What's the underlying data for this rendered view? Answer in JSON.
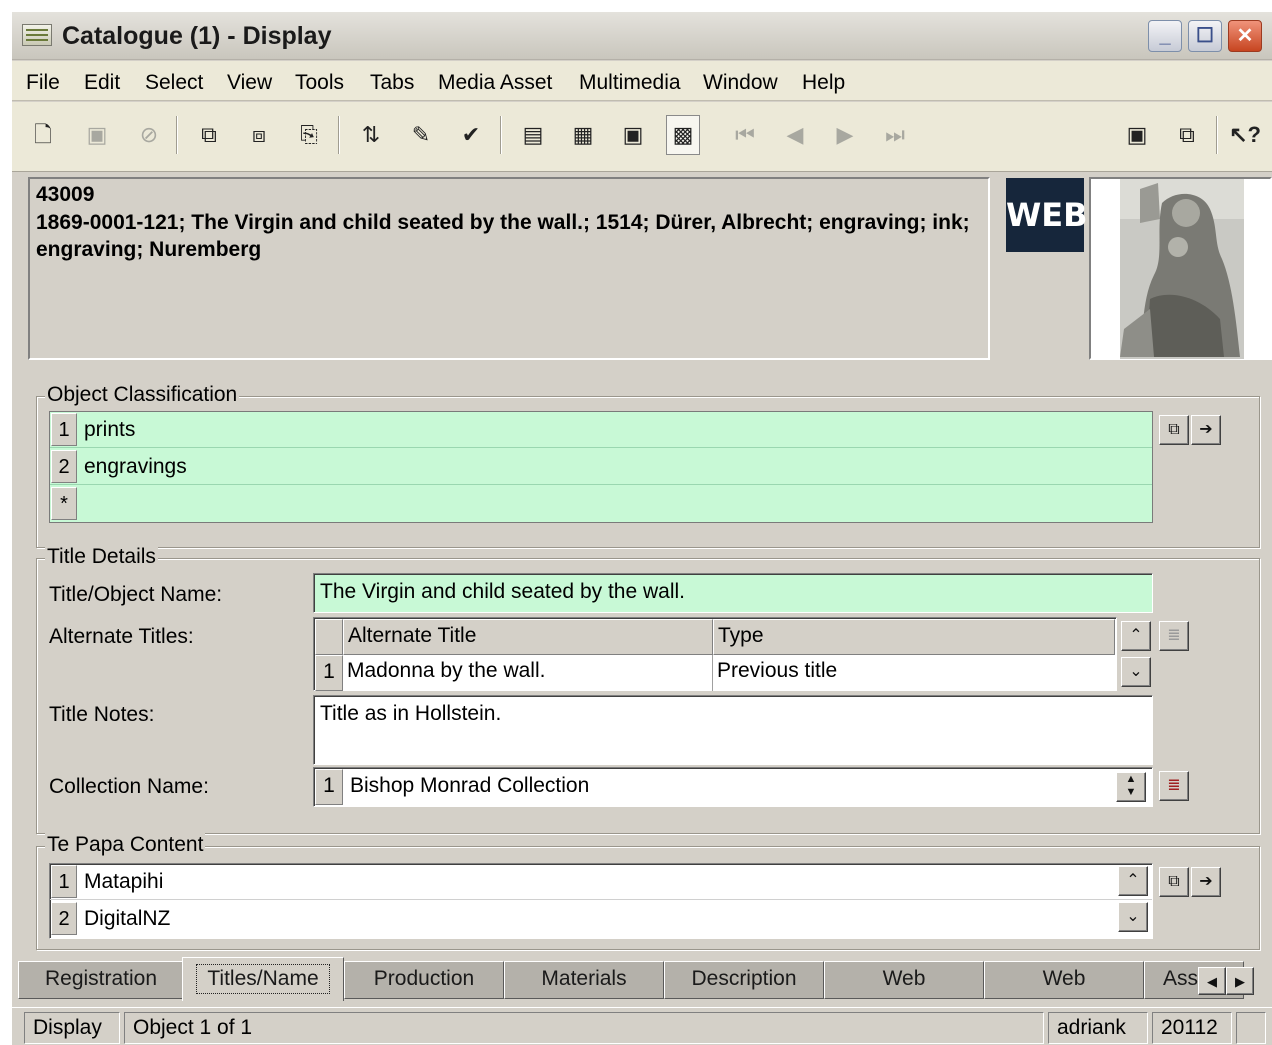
{
  "window": {
    "title": "Catalogue (1) - Display"
  },
  "menu": [
    "File",
    "Edit",
    "Select",
    "View",
    "Tools",
    "Tabs",
    "Media Asset",
    "Multimedia",
    "Window",
    "Help"
  ],
  "header": {
    "record_id": "43009",
    "description": "1869-0001-121; The Virgin and child seated by the wall.; 1514; Dürer, Albrecht; engraving; ink; engraving; Nuremberg",
    "web_badge": "WEB"
  },
  "object_classification": {
    "label": "Object Classification",
    "rows": [
      {
        "num": "1",
        "value": "prints"
      },
      {
        "num": "2",
        "value": "engravings"
      },
      {
        "num": "*",
        "value": ""
      }
    ]
  },
  "title_details": {
    "label": "Title Details",
    "title_label": "Title/Object Name:",
    "title_value": "The Virgin and child seated by the wall.",
    "alt_titles_label": "Alternate Titles:",
    "alt_col_title": "Alternate Title",
    "alt_col_type": "Type",
    "alt_rows": [
      {
        "num": "1",
        "title": "Madonna by the wall.",
        "type": "Previous title"
      }
    ],
    "notes_label": "Title Notes:",
    "notes_value": "Title as in Hollstein.",
    "collection_label": "Collection Name:",
    "collection_num": "1",
    "collection_value": "Bishop Monrad Collection"
  },
  "te_papa": {
    "label": "Te Papa Content",
    "rows": [
      {
        "num": "1",
        "value": "Matapihi"
      },
      {
        "num": "2",
        "value": "DigitalNZ"
      }
    ]
  },
  "tabs": [
    "Registration",
    "Titles/Name",
    "Production",
    "Materials",
    "Description",
    "Web",
    "Web",
    "Assoc"
  ],
  "active_tab": "Titles/Name",
  "status": {
    "mode": "Display",
    "position": "Object 1 of 1",
    "user": "adriank",
    "code": "20112"
  },
  "colors": {
    "field_green": "#c8f9d6",
    "window_bg": "#d4d0c8",
    "web_badge_bg": "#16263b"
  }
}
